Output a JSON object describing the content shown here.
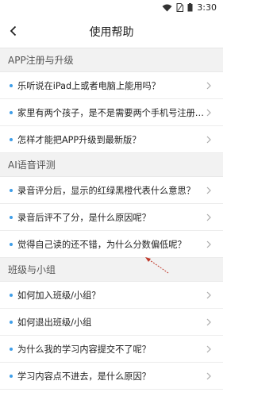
{
  "status_bar": {
    "time": "3:30"
  },
  "header": {
    "title": "使用帮助"
  },
  "sections": [
    {
      "title": "APP注册与升级",
      "items": [
        "乐听说在iPad上或者电脑上能用吗？",
        "家里有两个孩子，是不是需要两个手机号注册…",
        "怎样才能把APP升级到最新版？"
      ]
    },
    {
      "title": "AI语音评测",
      "items": [
        "录音评分后，显示的红绿黑橙代表什么意思？",
        "录音后评不了分，是什么原因呢？",
        "觉得自己读的还不错，为什么分数偏低呢？"
      ]
    },
    {
      "title": "班级与小组",
      "items": [
        "如何加入班级/小组？",
        "如何退出班级/小组",
        "为什么我的学习内容提交不了呢？",
        "学习内容点不进去，是什么原因？"
      ]
    }
  ],
  "colors": {
    "accent_dot": "#3f9ee8",
    "section_bg": "#f2f2f2",
    "annotation_arrow": "#c0392b"
  }
}
